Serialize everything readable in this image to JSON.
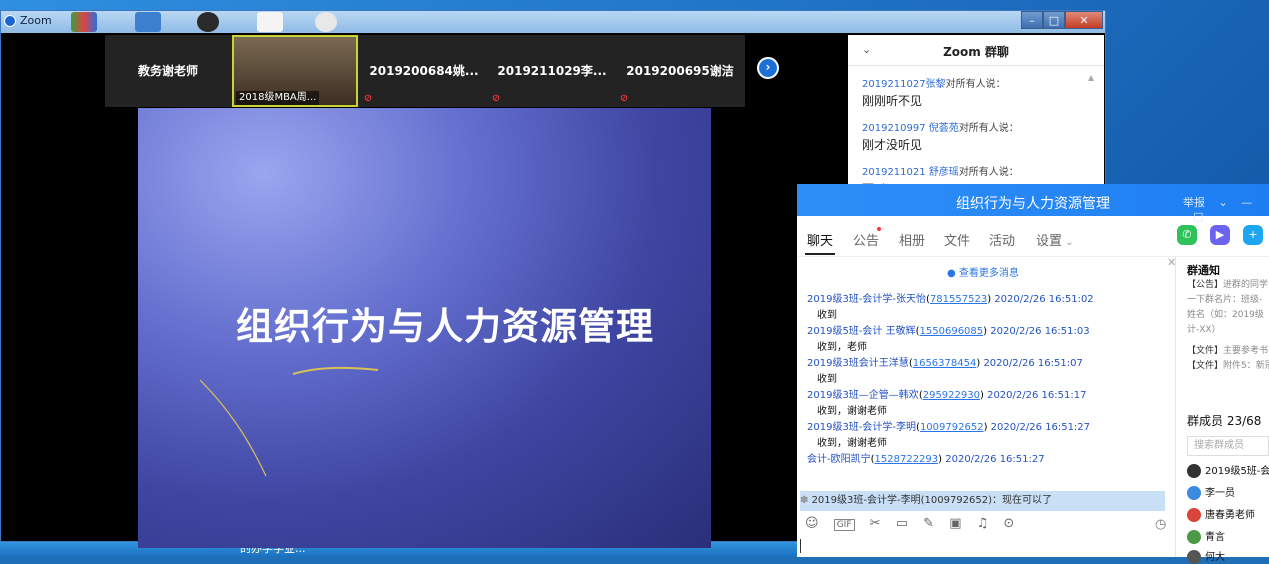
{
  "zoom": {
    "title": "Zoom",
    "participants": [
      {
        "name": "教务谢老师"
      },
      {
        "name": "2018级MBA周...",
        "active": true
      },
      {
        "name": "2019200684姚..."
      },
      {
        "name": "2019211029李..."
      },
      {
        "name": "2019200695谢洁"
      }
    ],
    "slide_title": "组织行为与人力资源管理",
    "chat": {
      "title": "Zoom 群聊",
      "messages": [
        {
          "sender": "2019211027张黎",
          "to": "对所有人说：",
          "text": "刚刚听不见"
        },
        {
          "sender": "2019210997 倪荟苑",
          "to": "对所有人说：",
          "text": "刚才没听见"
        },
        {
          "sender": "2019211021 舒彦瑶",
          "to": "对所有人说：",
          "text": "可以"
        }
      ]
    }
  },
  "taskbar": {
    "text": "的办学学业..."
  },
  "qq": {
    "title": "组织行为与人力资源管理",
    "report": "举报",
    "tabs": [
      "聊天",
      "公告",
      "相册",
      "文件",
      "活动",
      "设置"
    ],
    "more_messages": "查看更多消息",
    "messages": [
      {
        "name": "2019级3班-会计学-张天怡",
        "qq": "781557523",
        "time": "2020/2/26 16:51:02",
        "text": "收到"
      },
      {
        "name": "2019级5班-会计 王敬辉",
        "qq": "1550696085",
        "time": "2020/2/26 16:51:03",
        "text": "收到，老师"
      },
      {
        "name": "2019级3班会计王洋慧",
        "qq": "1656378454",
        "time": "2020/2/26 16:51:07",
        "text": "收到"
      },
      {
        "name": "2019级3班—企管—韩欢",
        "qq": "295922930",
        "time": "2020/2/26 16:51:17",
        "text": "收到，谢谢老师"
      },
      {
        "name": "2019级3班-会计学-李明",
        "qq": "1009792652",
        "time": "2020/2/26 16:51:27",
        "text": "收到，谢谢老师"
      },
      {
        "name": "会计-欧阳凯宁",
        "qq": "1528722293",
        "time": "2020/2/26 16:51:27",
        "text": ""
      }
    ],
    "notice_bar": "2019级3班-会计学-李明(1009792652)：现在可以了",
    "side": {
      "notice_title": "群通知",
      "notice_lines": [
        {
          "tag": "【公告】",
          "text": "进群的同学"
        },
        {
          "tag": "",
          "text": "一下群名片：班级-"
        },
        {
          "tag": "",
          "text": "姓名（如：2019级"
        },
        {
          "tag": "",
          "text": "计-XX）"
        },
        {
          "tag": "【文件】",
          "text": "主要参考书"
        },
        {
          "tag": "【文件】",
          "text": "附件5：新冠"
        }
      ],
      "members_label": "群成员 23/68",
      "search_placeholder": "搜索群成员",
      "members": [
        {
          "name": "2019级5班-会"
        },
        {
          "name": "李一员"
        },
        {
          "name": "唐春勇老师"
        },
        {
          "name": "青言"
        },
        {
          "name": "何大"
        }
      ]
    }
  }
}
